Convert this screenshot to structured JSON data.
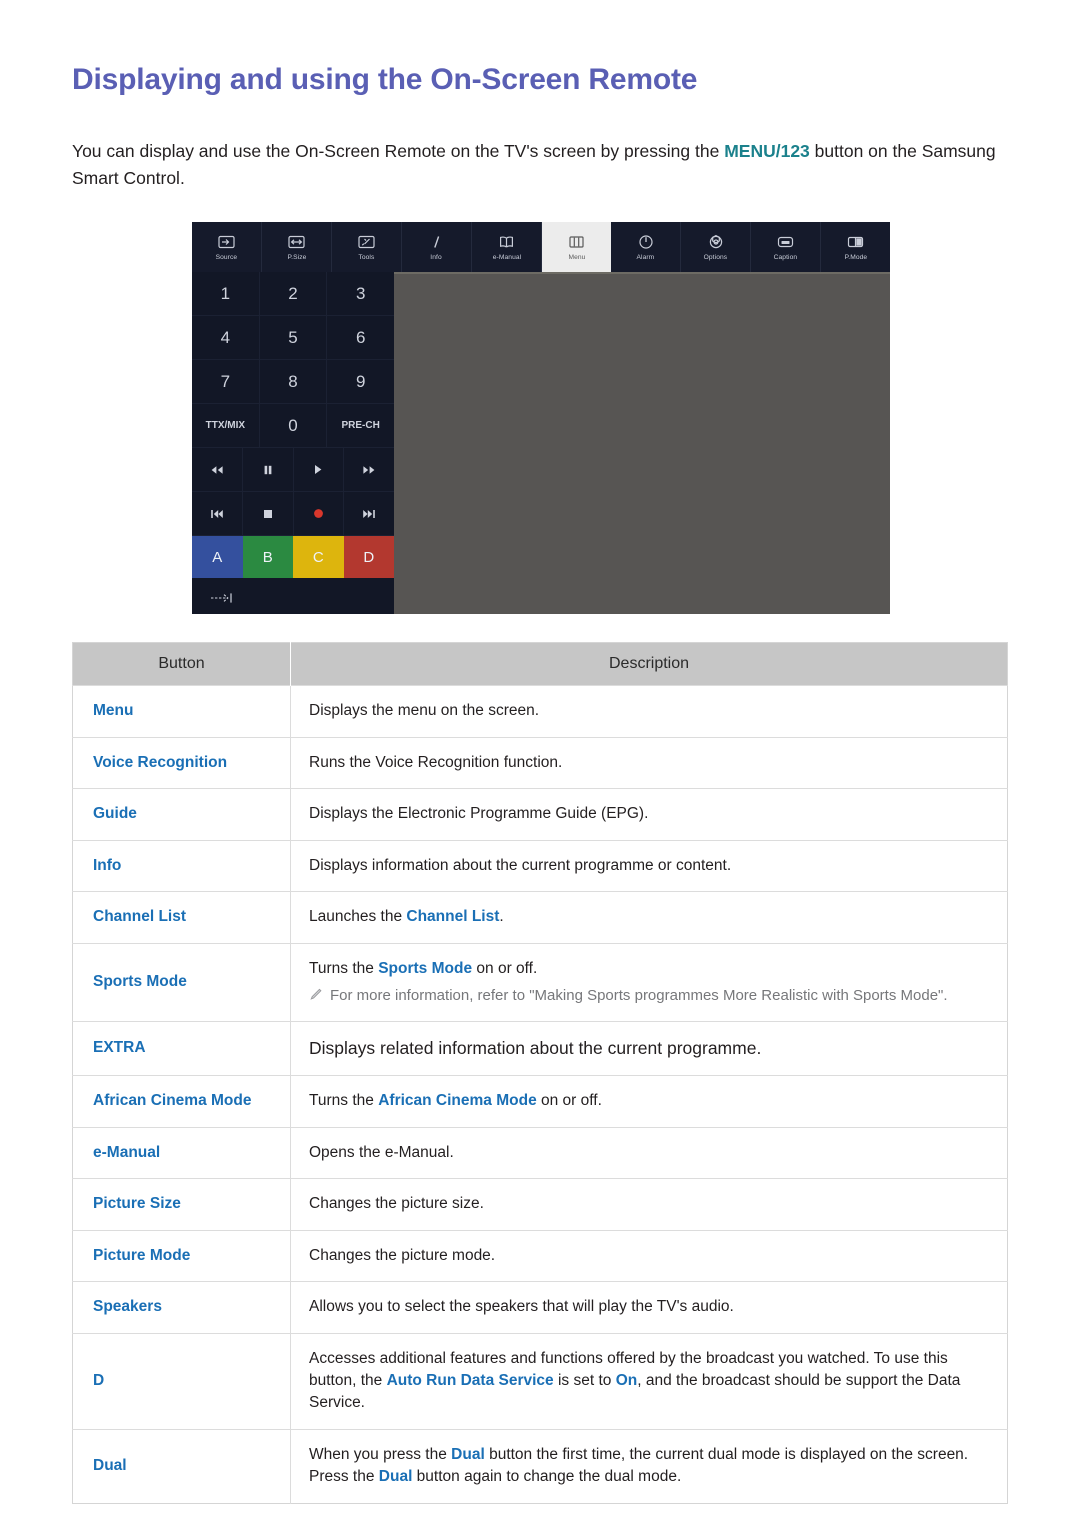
{
  "document": {
    "title": "Displaying and using the On-Screen Remote",
    "intro_before": "You can display and use the On-Screen Remote on the TV's screen by pressing the ",
    "intro_key": "MENU/123",
    "intro_after": " button on the Samsung Smart Control."
  },
  "colors": {
    "title": "#5a5fb4",
    "link": "#1a6fb5",
    "key_highlight": "#1b818c",
    "table_header_bg": "#c6c6c6",
    "remote_panel_bg": "#121726",
    "remote_strip_bg": "#151a2b",
    "remote_screen_bg": "#575553",
    "btn_a": "#34509e",
    "btn_b": "#2b8a41",
    "btn_c": "#ddb50d",
    "btn_d": "#b3382f",
    "record_red": "#d9372c",
    "note_text": "#76777a"
  },
  "remote": {
    "top_bar": [
      {
        "label": "Source",
        "icon": "source-icon",
        "active": false
      },
      {
        "label": "P.Size",
        "icon": "picture-size-icon",
        "active": false
      },
      {
        "label": "Tools",
        "icon": "tools-icon",
        "active": false
      },
      {
        "label": "Info",
        "icon": "info-icon",
        "active": false
      },
      {
        "label": "e-Manual",
        "icon": "e-manual-icon",
        "active": false
      },
      {
        "label": "Menu",
        "icon": "menu-icon",
        "active": true
      },
      {
        "label": "Alarm",
        "icon": "alarm-icon",
        "active": false
      },
      {
        "label": "Options",
        "icon": "options-gear-icon",
        "active": false
      },
      {
        "label": "Caption",
        "icon": "caption-icon",
        "active": false
      },
      {
        "label": "P.Mode",
        "icon": "picture-mode-icon",
        "active": false
      }
    ],
    "keypad": [
      [
        "1",
        "2",
        "3"
      ],
      [
        "4",
        "5",
        "6"
      ],
      [
        "7",
        "8",
        "9"
      ],
      [
        "TTX/MIX",
        "0",
        "PRE-CH"
      ]
    ],
    "media_row_1": [
      "rewind",
      "pause",
      "play",
      "fast-forward"
    ],
    "media_row_2": [
      "previous",
      "stop",
      "record",
      "next"
    ],
    "color_buttons": [
      {
        "label": "A",
        "color": "#34509e"
      },
      {
        "label": "B",
        "color": "#2b8a41"
      },
      {
        "label": "C",
        "color": "#ddb50d"
      },
      {
        "label": "D",
        "color": "#b3382f"
      }
    ],
    "bottom_key": "exit-arrow-icon"
  },
  "table": {
    "headers": {
      "button": "Button",
      "description": "Description"
    },
    "rows": [
      {
        "button": "Menu",
        "desc_parts": [
          {
            "t": "Displays the menu on the screen."
          }
        ]
      },
      {
        "button": "Voice Recognition",
        "desc_parts": [
          {
            "t": "Runs the Voice Recognition function."
          }
        ]
      },
      {
        "button": "Guide",
        "desc_parts": [
          {
            "t": "Displays the Electronic Programme Guide (EPG)."
          }
        ]
      },
      {
        "button": "Info",
        "desc_parts": [
          {
            "t": "Displays information about the current programme or content."
          }
        ]
      },
      {
        "button": "Channel List",
        "desc_parts": [
          {
            "t": "Launches the "
          },
          {
            "t": "Channel List",
            "link": true
          },
          {
            "t": "."
          }
        ]
      },
      {
        "button": "Sports Mode",
        "desc_parts": [
          {
            "t": "Turns the "
          },
          {
            "t": "Sports Mode",
            "link": true
          },
          {
            "t": " on or off."
          }
        ],
        "note": "For more information, refer to \"Making Sports programmes More Realistic with Sports Mode\"."
      },
      {
        "button": "EXTRA",
        "big": true,
        "desc_parts": [
          {
            "t": "Displays related information about the current programme."
          }
        ]
      },
      {
        "button": "African Cinema Mode",
        "desc_parts": [
          {
            "t": "Turns the "
          },
          {
            "t": "African Cinema Mode",
            "link": true
          },
          {
            "t": " on or off."
          }
        ]
      },
      {
        "button": "e-Manual",
        "desc_parts": [
          {
            "t": "Opens the e-Manual."
          }
        ]
      },
      {
        "button": "Picture Size",
        "desc_parts": [
          {
            "t": "Changes the picture size."
          }
        ]
      },
      {
        "button": "Picture Mode",
        "desc_parts": [
          {
            "t": "Changes the picture mode."
          }
        ]
      },
      {
        "button": "Speakers",
        "desc_parts": [
          {
            "t": "Allows you to select the speakers that will play the TV's audio."
          }
        ]
      },
      {
        "button": "D",
        "desc_parts": [
          {
            "t": "Accesses additional features and functions offered by the broadcast you watched. To use this button, the "
          },
          {
            "t": "Auto Run Data Service",
            "link": true
          },
          {
            "t": " is set to "
          },
          {
            "t": "On",
            "link": true
          },
          {
            "t": ", and the broadcast should be support the Data Service."
          }
        ]
      },
      {
        "button": "Dual",
        "desc_parts": [
          {
            "t": "When you press the "
          },
          {
            "t": "Dual",
            "link": true
          },
          {
            "t": " button the first time, the current dual mode is displayed on the screen."
          },
          {
            "br": true
          },
          {
            "t": "Press the "
          },
          {
            "t": "Dual",
            "link": true
          },
          {
            "t": " button again to change the dual mode."
          }
        ]
      }
    ]
  }
}
